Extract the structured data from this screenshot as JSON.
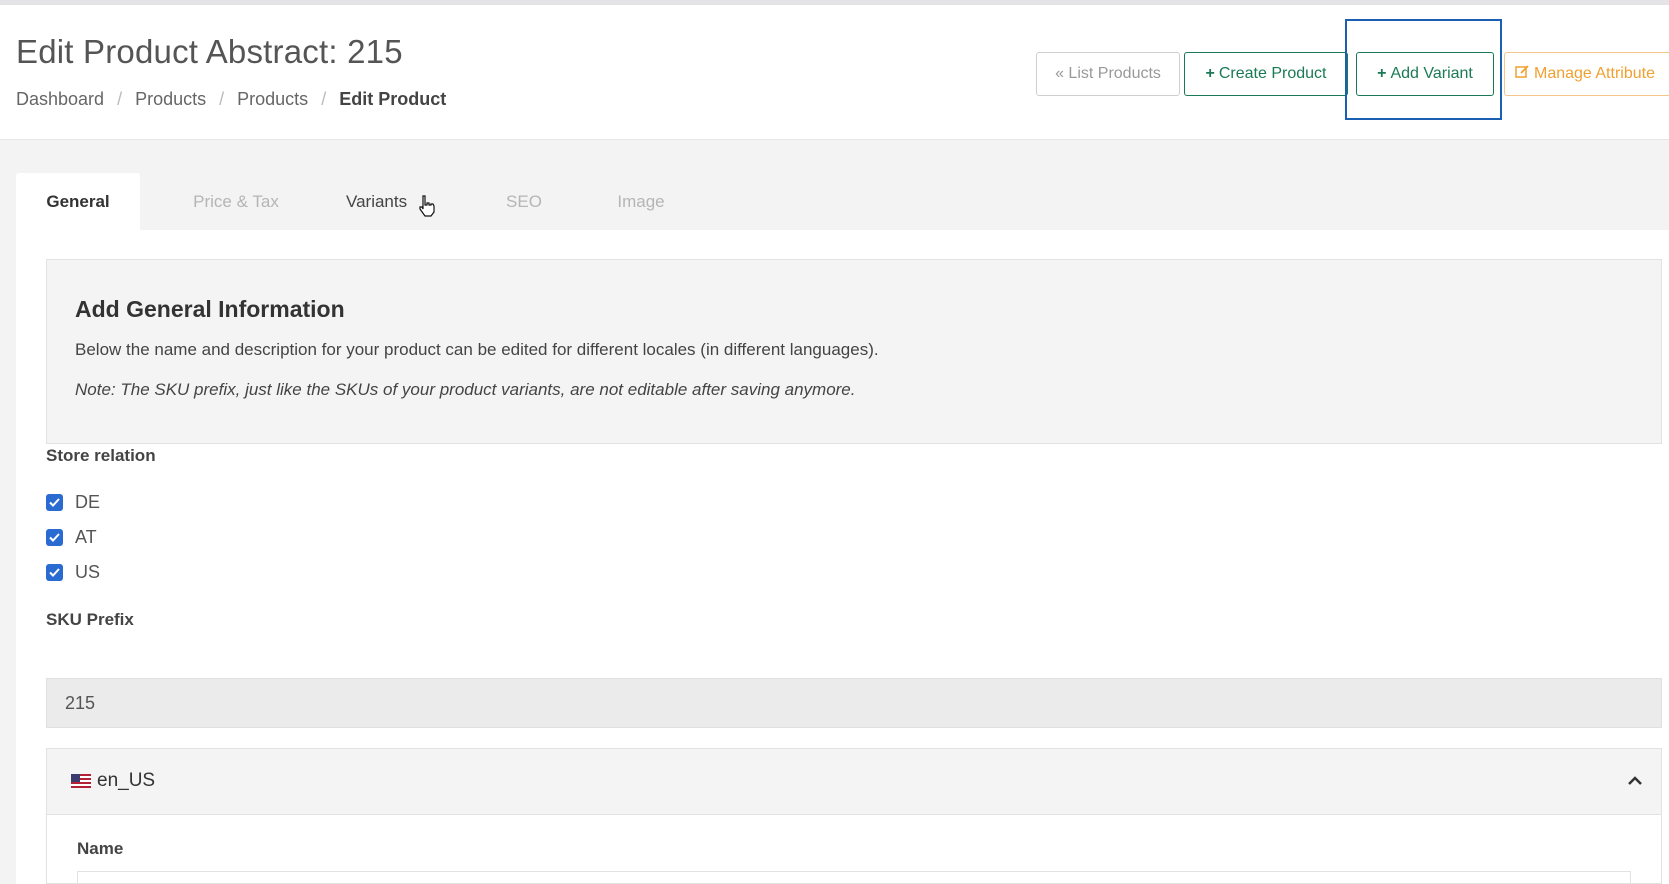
{
  "header": {
    "title": "Edit Product Abstract: 215",
    "breadcrumb": [
      "Dashboard",
      "Products",
      "Products",
      "Edit Product"
    ],
    "separator": "/",
    "buttons": {
      "list_products": "« List Products",
      "create_product": "Create Product",
      "add_variant": "Add Variant",
      "manage_attributes": "Manage Attribute"
    }
  },
  "tabs": [
    "General",
    "Price & Tax",
    "Variants",
    "SEO",
    "Image"
  ],
  "general": {
    "info_title": "Add General Information",
    "info_description": "Below the name and description for your product can be edited for different locales (in different languages).",
    "info_note": "Note: The SKU prefix, just like the SKUs of your product variants, are not editable after saving anymore.",
    "store_relation_label": "Store relation",
    "stores": [
      "DE",
      "AT",
      "US"
    ],
    "sku_prefix_label": "SKU Prefix",
    "sku_prefix_value": "215",
    "locale": "en_US",
    "name_label": "Name"
  },
  "colors": {
    "accent_green": "#1a7a55",
    "accent_orange": "#f0a030",
    "checkbox_blue": "#2a6bd1",
    "highlight_blue": "#1b5fb3"
  },
  "icons": [
    "plus-icon",
    "edit-icon",
    "checkbox-checked-icon",
    "us-flag-icon",
    "chevron-up-icon",
    "hand-cursor-icon"
  ]
}
